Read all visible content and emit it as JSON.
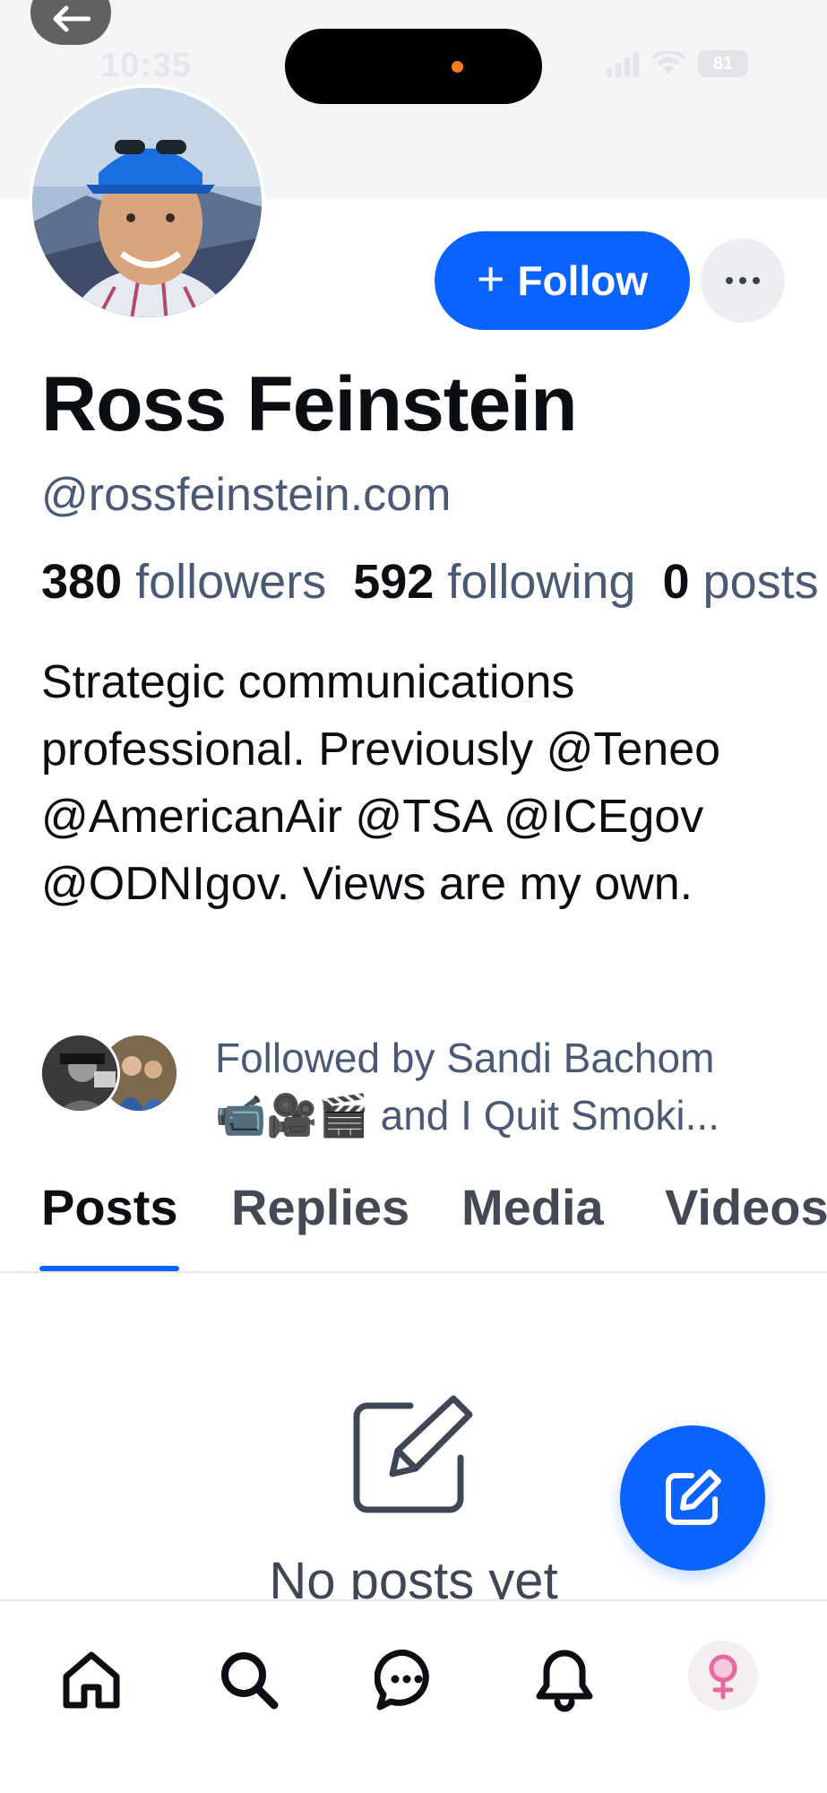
{
  "status_bar": {
    "time": "10:35",
    "battery": "81"
  },
  "profile": {
    "display_name": "Ross Feinstein",
    "handle": "@rossfeinstein.com",
    "followers_count": "380",
    "followers_label": "followers",
    "following_count": "592",
    "following_label": "following",
    "posts_count": "0",
    "posts_label": "posts",
    "bio": "Strategic communications professional. Previously @Teneo @AmericanAir @TSA @ICEgov @ODNIgov. Views are my own.",
    "followed_by_line1": "Followed by Sandi Bachom",
    "followed_by_line2": "📹🎥🎬 and I Quit Smoki..."
  },
  "actions": {
    "follow_label": "Follow"
  },
  "tabs": [
    {
      "label": "Posts",
      "active": true
    },
    {
      "label": "Replies",
      "active": false
    },
    {
      "label": "Media",
      "active": false
    },
    {
      "label": "Videos",
      "active": false
    }
  ],
  "empty_state": {
    "message": "No posts yet",
    "icon": "edit-square-icon"
  },
  "bottom_nav": [
    {
      "icon": "home-icon"
    },
    {
      "icon": "search-icon"
    },
    {
      "icon": "chat-icon"
    },
    {
      "icon": "bell-icon"
    },
    {
      "icon": "profile-avatar"
    }
  ],
  "colors": {
    "accent": "#0a63ff",
    "muted_text": "#4a5a74",
    "banner": "#f3f4f6"
  }
}
